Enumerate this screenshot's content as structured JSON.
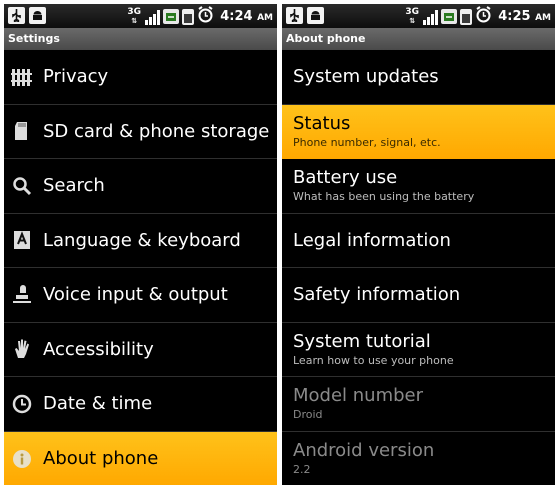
{
  "left_screen": {
    "status_time": "4:24",
    "status_ampm": "AM",
    "network": "3G",
    "title": "Settings",
    "items": [
      {
        "label": "Privacy",
        "icon": "privacy-icon"
      },
      {
        "label": "SD card & phone storage",
        "icon": "sd-card-icon"
      },
      {
        "label": "Search",
        "icon": "search-icon"
      },
      {
        "label": "Language & keyboard",
        "icon": "keyboard-icon"
      },
      {
        "label": "Voice input & output",
        "icon": "voice-icon"
      },
      {
        "label": "Accessibility",
        "icon": "accessibility-hand-icon"
      },
      {
        "label": "Date & time",
        "icon": "clock-icon"
      },
      {
        "label": "About phone",
        "icon": "info-icon",
        "selected": true
      }
    ]
  },
  "right_screen": {
    "status_time": "4:25",
    "status_ampm": "AM",
    "network": "3G",
    "title": "About phone",
    "items": [
      {
        "label": "System updates",
        "sub": ""
      },
      {
        "label": "Status",
        "sub": "Phone number, signal, etc.",
        "selected": true
      },
      {
        "label": "Battery use",
        "sub": "What has been using the battery"
      },
      {
        "label": "Legal information",
        "sub": ""
      },
      {
        "label": "Safety information",
        "sub": ""
      },
      {
        "label": "System tutorial",
        "sub": "Learn how to use your phone"
      },
      {
        "label": "Model number",
        "sub": "Droid",
        "disabled": true
      },
      {
        "label": "Android version",
        "sub": "2.2",
        "disabled": true
      }
    ]
  },
  "colors": {
    "selection": "#ffb400",
    "background": "#000000",
    "titlebar": "#5a5a5a"
  }
}
